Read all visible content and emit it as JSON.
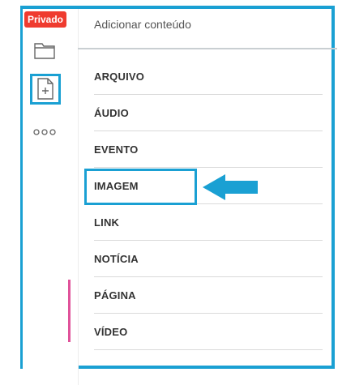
{
  "sidebar": {
    "badge": "Privado",
    "icons": [
      "folder-icon",
      "add-page-icon",
      "more-options-icon"
    ]
  },
  "panel": {
    "title": "Adicionar conteúdo",
    "items": [
      {
        "label": "ARQUIVO"
      },
      {
        "label": "ÁUDIO"
      },
      {
        "label": "EVENTO"
      },
      {
        "label": "IMAGEM"
      },
      {
        "label": "LINK"
      },
      {
        "label": "NOTÍCIA"
      },
      {
        "label": "PÁGINA"
      },
      {
        "label": "VÍDEO"
      }
    ]
  },
  "colors": {
    "highlight": "#1aa0d3",
    "badge": "#ef3b2f",
    "accent": "#e0529a"
  }
}
